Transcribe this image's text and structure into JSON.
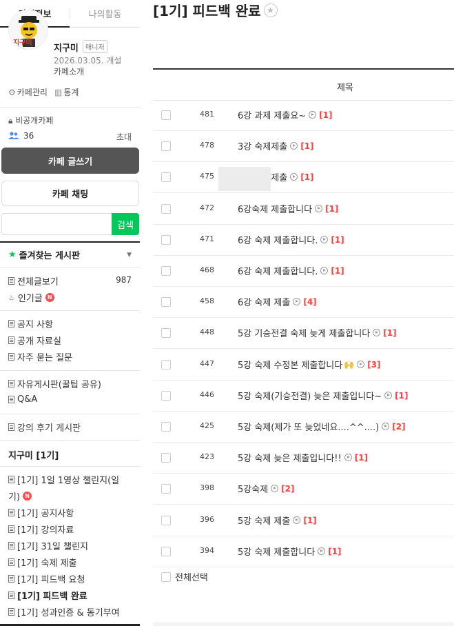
{
  "sidebar": {
    "tabs": [
      {
        "label": "카페정보"
      },
      {
        "label": "나의활동"
      }
    ],
    "profile": {
      "nickname": "지구미",
      "role": "매니저",
      "open_date": "2026.03.05. 개설",
      "intro_link": "카페소개",
      "avatar_text": "지구미"
    },
    "management": {
      "manage_label": "카페관리",
      "stats_label": "통계"
    },
    "privacy_label": "비공개카페",
    "member_count": "36",
    "invite_label": "초대",
    "write_button": "카페 글쓰기",
    "chat_button": "카페 채팅",
    "search": {
      "placeholder": "",
      "button_label": "검색"
    },
    "favorites_label": "즐겨찾는 게시판",
    "menu": {
      "all_posts": "전체글보기",
      "all_posts_count": "987",
      "popular": "인기글",
      "notice": "공지 사항",
      "public_resources": "공개 자료실",
      "faq": "자주 묻는 질문",
      "free_board": "자유게시판(꿀팁 공유)",
      "qna": "Q&A",
      "reviews": "강의 후기 게시판",
      "group_title": "지구미 [1기]",
      "challenge_line1": "[1기] 1일 1영상 챌린지(일",
      "challenge_line2": "기)",
      "g_notice": "[1기] 공지사항",
      "g_materials": "[1기] 강의자료",
      "g_31day": "[1기] 31일 챌린지",
      "g_homework": "[1기] 숙제 제출",
      "g_feedback_req": "[1기] 피드백 요청",
      "g_feedback_done": "[1기] 피드백 완료",
      "g_motivation": "[1기] 성과인증 & 동기부여"
    },
    "new_badge": "N"
  },
  "main": {
    "board_title": "[1기] 피드백 완료",
    "column_title": "제목",
    "rows": [
      {
        "num": "481",
        "title": "6강 과제 제출요~",
        "reply": "[1]"
      },
      {
        "num": "478",
        "title": "3강 숙제제출",
        "reply": "[1]"
      },
      {
        "num": "475",
        "title": "5강 숙제제출",
        "reply": "[1]"
      },
      {
        "num": "472",
        "title": "6강숙제 제출합니다",
        "reply": "[1]"
      },
      {
        "num": "471",
        "title": "6강 숙제 제출합니다.",
        "reply": "[1]"
      },
      {
        "num": "468",
        "title": "6강 숙제 제출합니다.",
        "reply": "[1]"
      },
      {
        "num": "458",
        "title": "6강 숙제 제출",
        "reply": "[4]"
      },
      {
        "num": "448",
        "title": "5강 기승전결 숙제 늦게 제출합니다",
        "reply": "[1]"
      },
      {
        "num": "447",
        "title": "5강 숙제 수정본 제출합니다",
        "reply": "[3]",
        "emoji": "🙌"
      },
      {
        "num": "446",
        "title": "5강 숙제(기승전결) 늦은 제출입니다~",
        "reply": "[1]"
      },
      {
        "num": "425",
        "title": "5강 숙제(제가 또 늦었네요....^^....)",
        "reply": "[2]"
      },
      {
        "num": "423",
        "title": "5강 숙제 늦은 제출입니다!!",
        "reply": "[1]"
      },
      {
        "num": "398",
        "title": "5강숙제",
        "reply": "[2]"
      },
      {
        "num": "396",
        "title": "5강 숙제 제출",
        "reply": "[1]"
      },
      {
        "num": "394",
        "title": "5강 숙제 제출합니다",
        "reply": "[1]"
      }
    ],
    "select_all_label": "전체선택"
  },
  "colors": {
    "accent_green": "#03c75a",
    "reply_red": "#ff3b3b",
    "write_button_bg": "#555555"
  }
}
